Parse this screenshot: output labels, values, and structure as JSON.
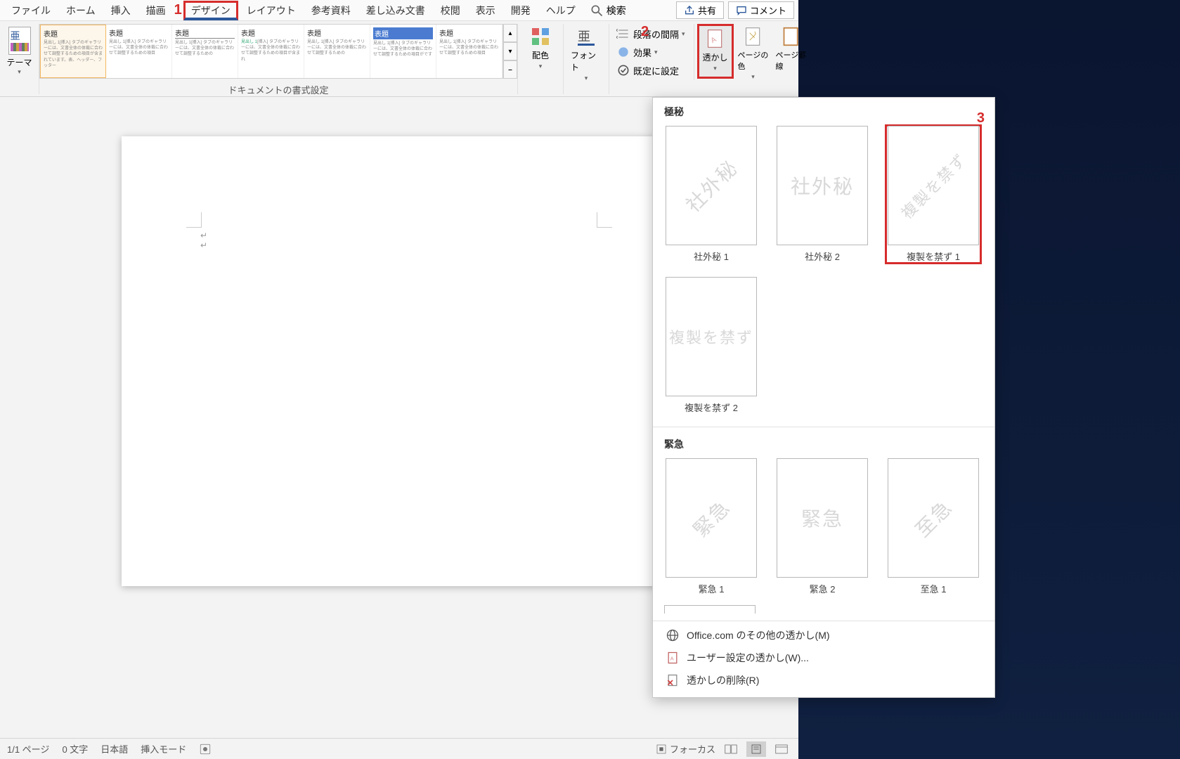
{
  "menubar": {
    "items": [
      "ファイル",
      "ホーム",
      "挿入",
      "描画",
      "デザイン",
      "レイアウト",
      "参考資料",
      "差し込み文書",
      "校閲",
      "表示",
      "開発",
      "ヘルプ"
    ],
    "active": "デザイン",
    "search": "検索",
    "share": "共有",
    "comment": "コメント"
  },
  "annotations": {
    "a1": "1",
    "a2": "2",
    "a3": "3"
  },
  "ribbon": {
    "theme": "テーマ",
    "styles": [
      {
        "title": "表題",
        "h1": "見出し 1",
        "body": "[挿入] タブのギャラリーには、文書全体の体裁に合わせて調整するための項目が含まれています。表、ヘッダー、フッター"
      },
      {
        "title": "表題",
        "h1": "見出し 1",
        "body": "[挿入] タブのギャラリーには、文書全体の体裁に合わせて調整するための項目"
      },
      {
        "title": "表題",
        "h1": "見出し 1",
        "body": "[挿入] タブのギャラリーには、文書全体の体裁に合わせて調整するための"
      },
      {
        "title": "表題",
        "h1": "見出し 1",
        "body": "[挿入] タブのギャラリーには、文書全体の体裁に合わせて調整するための項目が含まれ"
      },
      {
        "title": "表題",
        "h1": "見出し 1",
        "body": "[挿入] タブのギャラリーには、文書全体の体裁に合わせて調整するための"
      },
      {
        "title": "表題",
        "h1": "見出し 1",
        "body": "[挿入] タブのギャラリーには、文書全体の体裁に合わせて調整するための項目がです"
      },
      {
        "title": "表題",
        "h1": "見出し 1",
        "body": "[挿入] タブのギャラリーには、文書全体の体裁に合わせて調整するための項目"
      }
    ],
    "format_label": "ドキュメントの書式設定",
    "colors": "配色",
    "fonts": "フォント",
    "spacing": "段落の間隔",
    "effects": "効果",
    "set_default": "既定に設定",
    "watermark": "透かし",
    "page_color": "ページの色",
    "page_border": "ページ罫線"
  },
  "watermark_panel": {
    "section1": "極秘",
    "section2": "緊急",
    "items1": [
      {
        "text": "社外秘",
        "label": "社外秘 1",
        "diag": true
      },
      {
        "text": "社外秘",
        "label": "社外秘 2",
        "diag": false
      },
      {
        "text": "複製を禁ず",
        "label": "複製を禁ず 1",
        "diag": true
      },
      {
        "text": "複製を禁ず",
        "label": "複製を禁ず 2",
        "diag": false
      }
    ],
    "items2": [
      {
        "text": "緊急",
        "label": "緊急 1",
        "diag": true
      },
      {
        "text": "緊急",
        "label": "緊急 2",
        "diag": false
      },
      {
        "text": "至急",
        "label": "至急 1",
        "diag": true
      }
    ],
    "more": "Office.com のその他の透かし(M)",
    "custom": "ユーザー設定の透かし(W)...",
    "remove": "透かしの削除(R)"
  },
  "statusbar": {
    "page": "1/1 ページ",
    "words": "0 文字",
    "lang": "日本語",
    "insert": "挿入モード",
    "focus": "フォーカス"
  }
}
